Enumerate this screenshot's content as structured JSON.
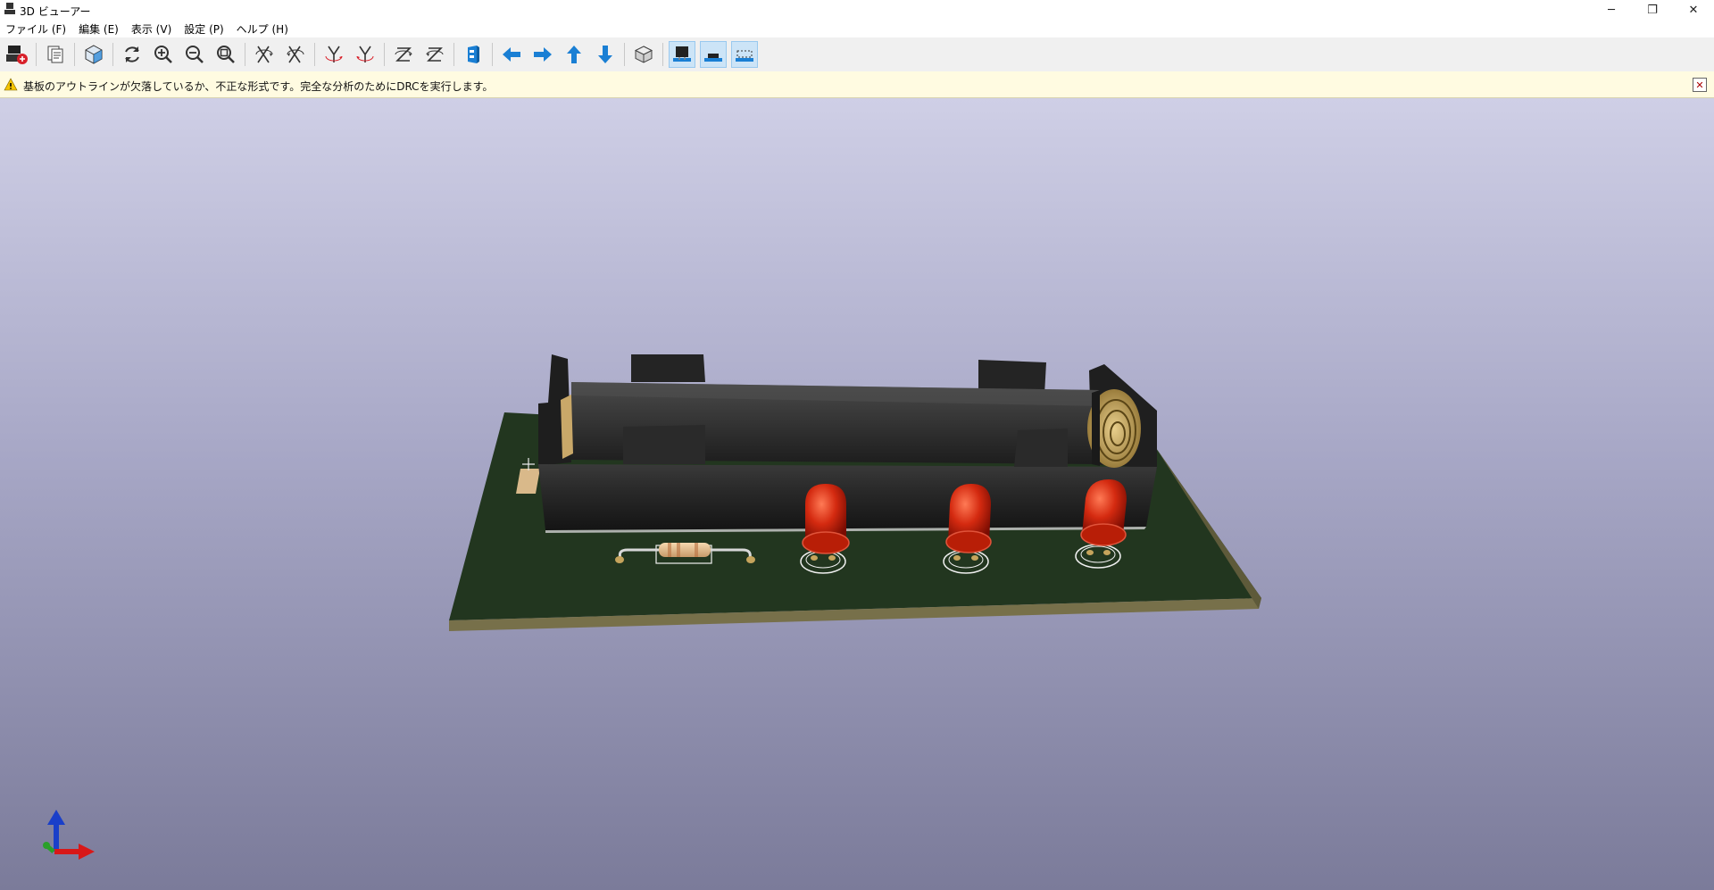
{
  "window": {
    "title": "3D ビューアー",
    "min_glyph": "─",
    "max_glyph": "❐",
    "close_glyph": "✕"
  },
  "menu": [
    {
      "label": "ファイル (F)"
    },
    {
      "label": "編集 (E)"
    },
    {
      "label": "表示 (V)"
    },
    {
      "label": "設定 (P)"
    },
    {
      "label": "ヘルプ (H)"
    }
  ],
  "toolbar": {
    "icons": [
      "render-board-icon",
      "copy-image-icon",
      "raytracing-icon",
      "reload-icon",
      "zoom-in-icon",
      "zoom-out-icon",
      "zoom-fit-icon",
      "rotate-x-cw-icon",
      "rotate-x-ccw-icon",
      "rotate-y-cw-icon",
      "rotate-y-ccw-icon",
      "rotate-z-cw-icon",
      "rotate-z-ccw-icon",
      "flip-board-icon",
      "move-left-icon",
      "move-right-icon",
      "move-up-icon",
      "move-down-icon",
      "orthographic-icon",
      "show-tht-icon",
      "show-smd-icon",
      "show-virtual-icon"
    ],
    "active_toggles": [
      "show-tht-icon",
      "show-smd-icon",
      "show-virtual-icon"
    ]
  },
  "warning": {
    "text": "基板のアウトラインが欠落しているか、不正な形式です。完全な分析のためにDRCを実行します。",
    "close_glyph": "✕"
  },
  "colors": {
    "accent": "#1a7fd4",
    "board": "#22361f",
    "silkscreen": "#f2f2f2",
    "led": "#c01a0a"
  }
}
